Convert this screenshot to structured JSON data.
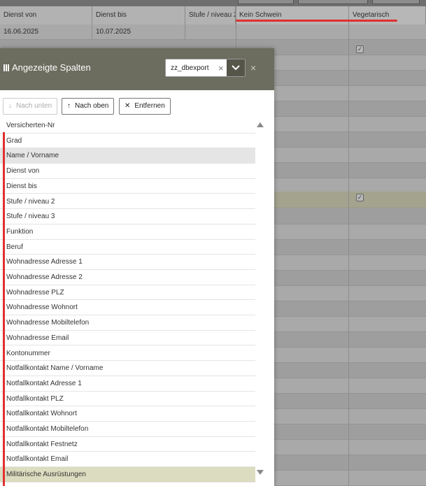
{
  "background": {
    "columns": [
      "Dienst von",
      "Dienst bis",
      "Stufe / niveau 2",
      "Kein Schwein",
      "Vegetarisch"
    ],
    "first_row": [
      "16.06.2025",
      "10.07.2025"
    ]
  },
  "dialog": {
    "title": "Angezeigte Spalten",
    "select_value": "zz_dbexport",
    "buttons": {
      "down": "Nach unten",
      "up": "Nach oben",
      "remove": "Entfernen"
    },
    "items": [
      "Versicherten-Nr",
      "Grad",
      "Name / Vorname",
      "Dienst von",
      "Dienst bis",
      "Stufe / niveau 2",
      "Stufe / niveau 3",
      "Funktion",
      "Beruf",
      "Wohnadresse Adresse 1",
      "Wohnadresse Adresse 2",
      "Wohnadresse PLZ",
      "Wohnadresse Wohnort",
      "Wohnadresse Mobiltelefon",
      "Wohnadresse Email",
      "Kontonummer",
      "Notfallkontakt Name / Vorname",
      "Notfallkontakt Adresse 1",
      "Notfallkontakt PLZ",
      "Notfallkontakt Wohnort",
      "Notfallkontakt Mobiltelefon",
      "Notfallkontakt Festnetz",
      "Notfallkontakt Email",
      "Militärische Ausrüstungen"
    ]
  },
  "colors": {
    "header_bar": "#6c6c5f",
    "highlight_green": "#dcdcc0",
    "highlight_grey": "#e5e5e5",
    "annotation_red": "#e03030"
  }
}
